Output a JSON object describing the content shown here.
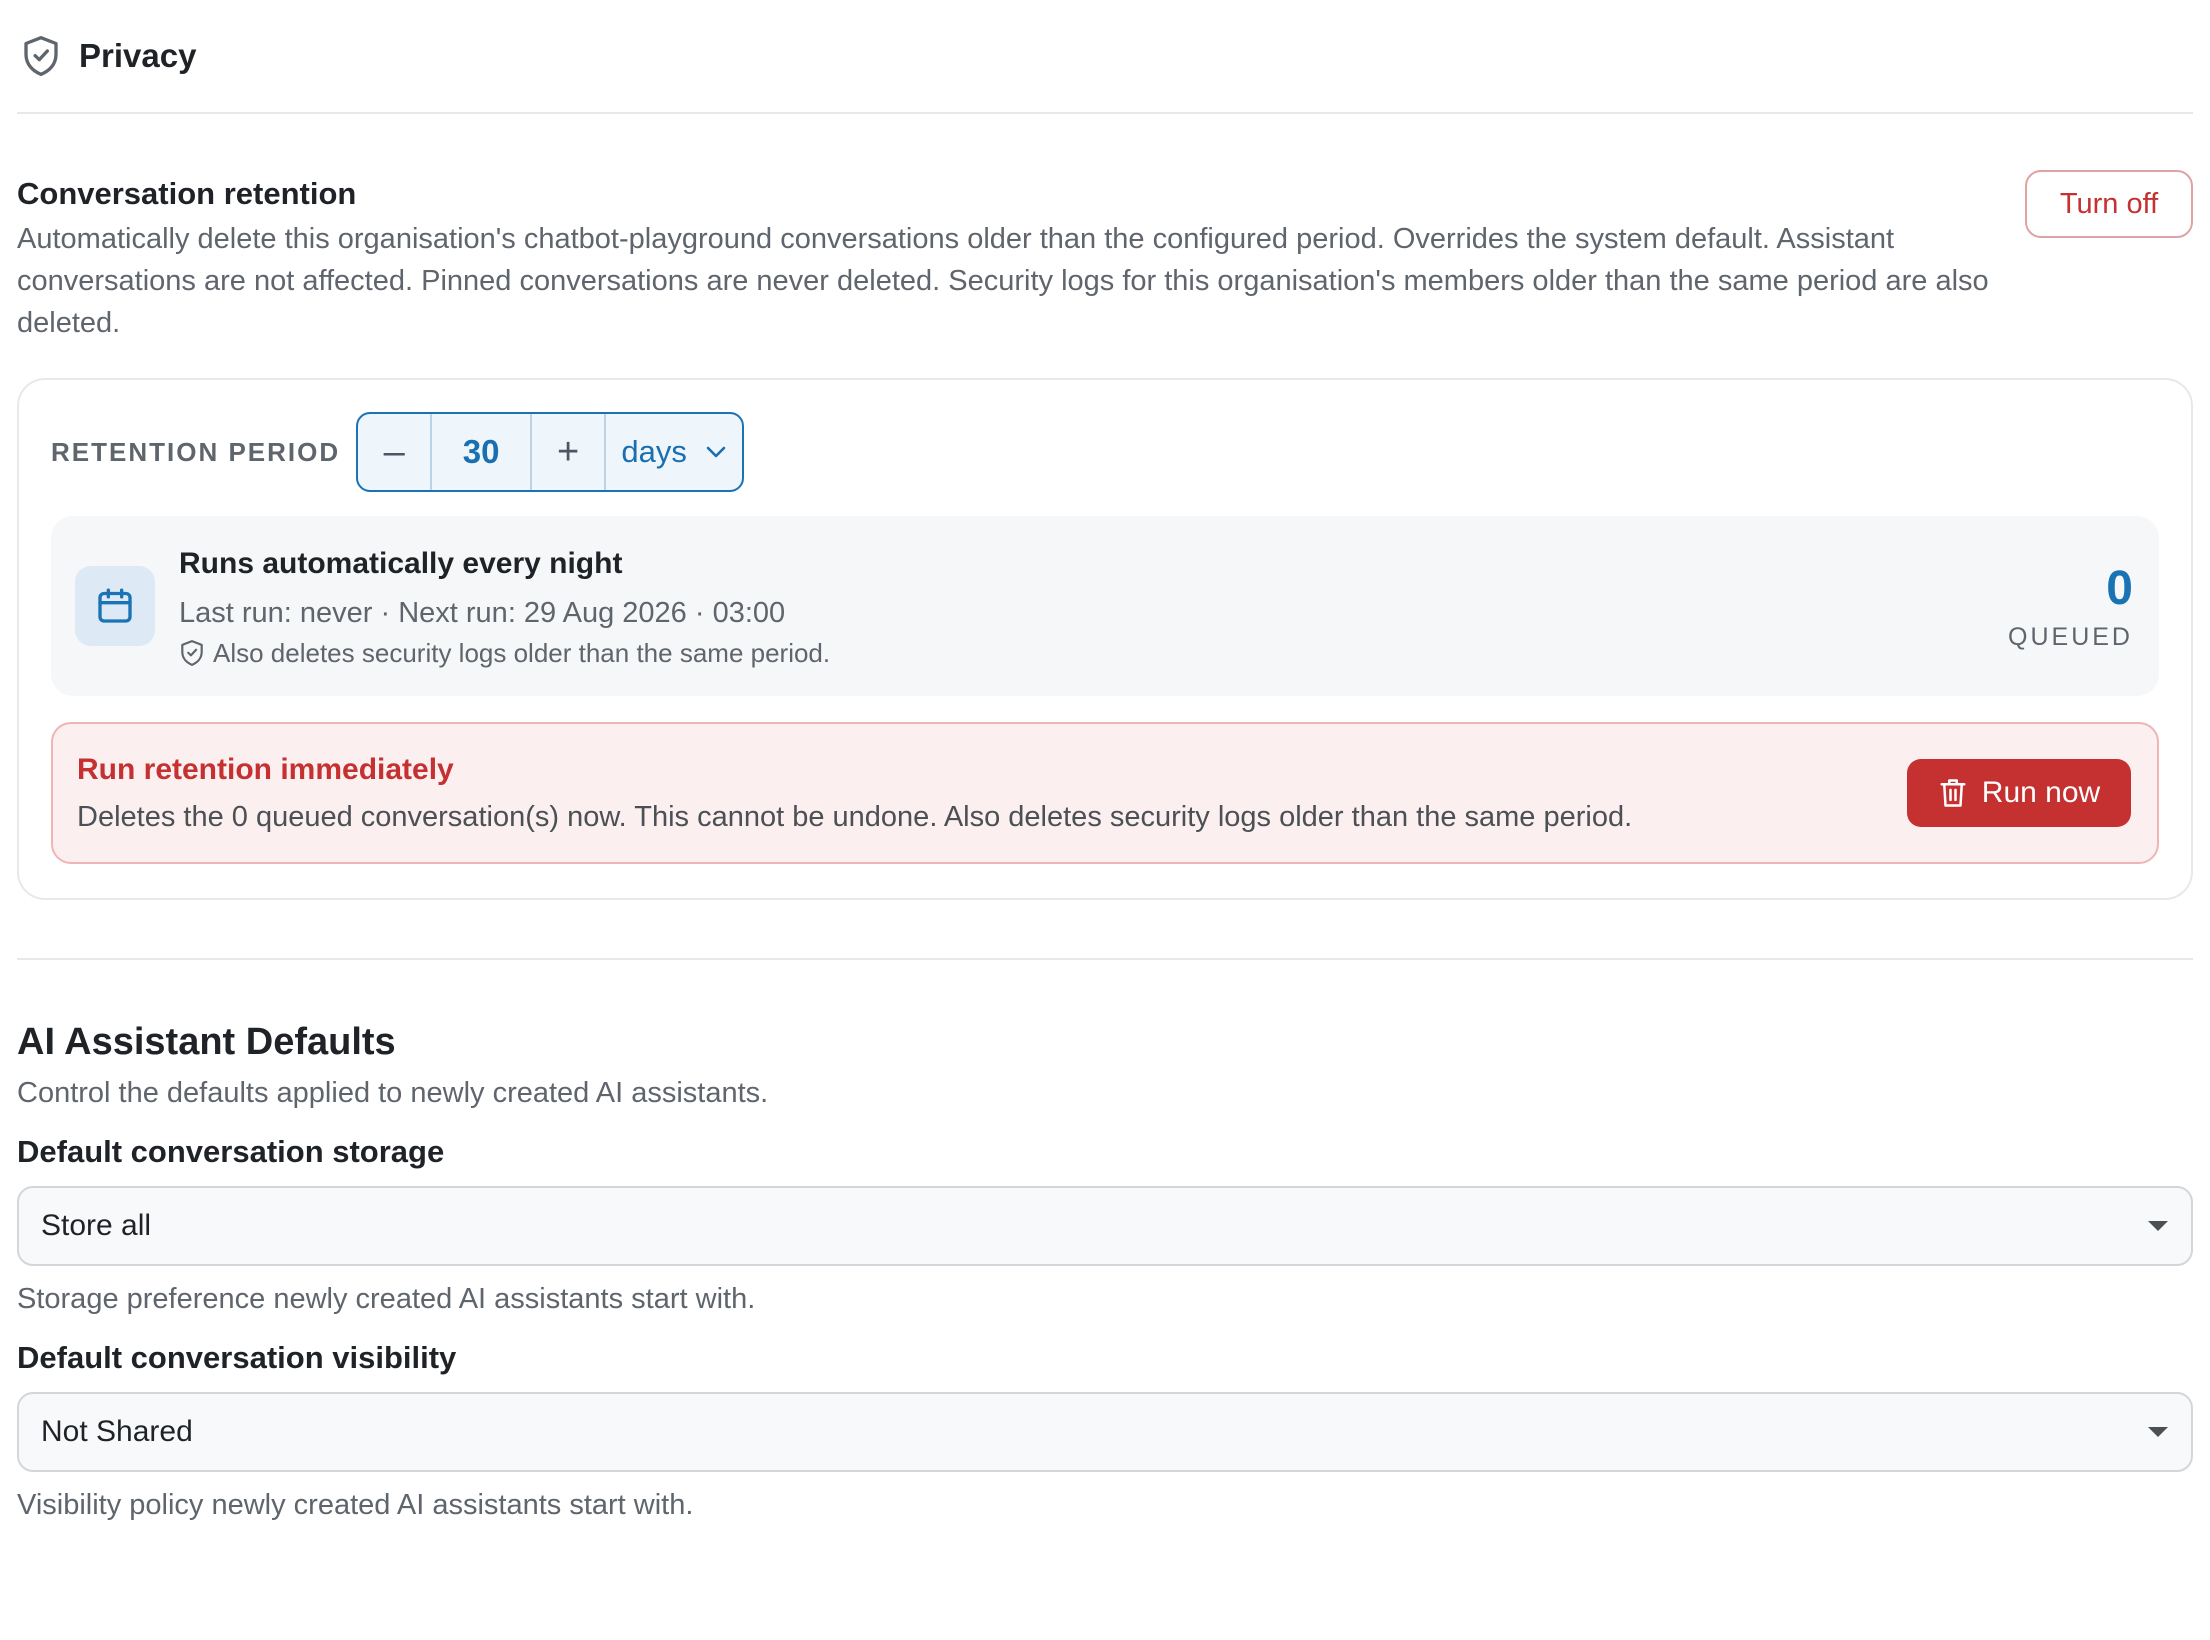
{
  "header": {
    "title": "Privacy",
    "icon": "shield-check-icon"
  },
  "retention": {
    "title": "Conversation retention",
    "description": "Automatically delete this organisation's chatbot-playground conversations older than the configured period. Overrides the system default. Assistant conversations are not affected. Pinned conversations are never deleted. Security logs for this organisation's members older than the same period are also deleted.",
    "turn_off_label": "Turn off",
    "period_label": "RETENTION PERIOD",
    "period_value": "30",
    "period_unit": "days",
    "minus_glyph": "–",
    "plus_glyph": "+",
    "schedule": {
      "title": "Runs automatically every night",
      "meta": "Last run: never · Next run: 29 Aug 2026 · 03:00",
      "note": "Also deletes security logs older than the same period."
    },
    "queued": {
      "count": "0",
      "label": "QUEUED"
    },
    "danger": {
      "title": "Run retention immediately",
      "description": "Deletes the 0 queued conversation(s) now. This cannot be undone. Also deletes security logs older than the same period.",
      "button_label": "Run now"
    }
  },
  "ai_defaults": {
    "title": "AI Assistant Defaults",
    "description": "Control the defaults applied to newly created AI assistants.",
    "storage": {
      "label": "Default conversation storage",
      "value": "Store all",
      "help": "Storage preference newly created AI assistants start with."
    },
    "visibility": {
      "label": "Default conversation visibility",
      "value": "Not Shared",
      "help": "Visibility policy newly created AI assistants start with."
    }
  },
  "colors": {
    "accent": "#1a73b5",
    "danger": "#c53030",
    "danger_bg": "#fcefef",
    "muted_text": "#5f656c"
  }
}
